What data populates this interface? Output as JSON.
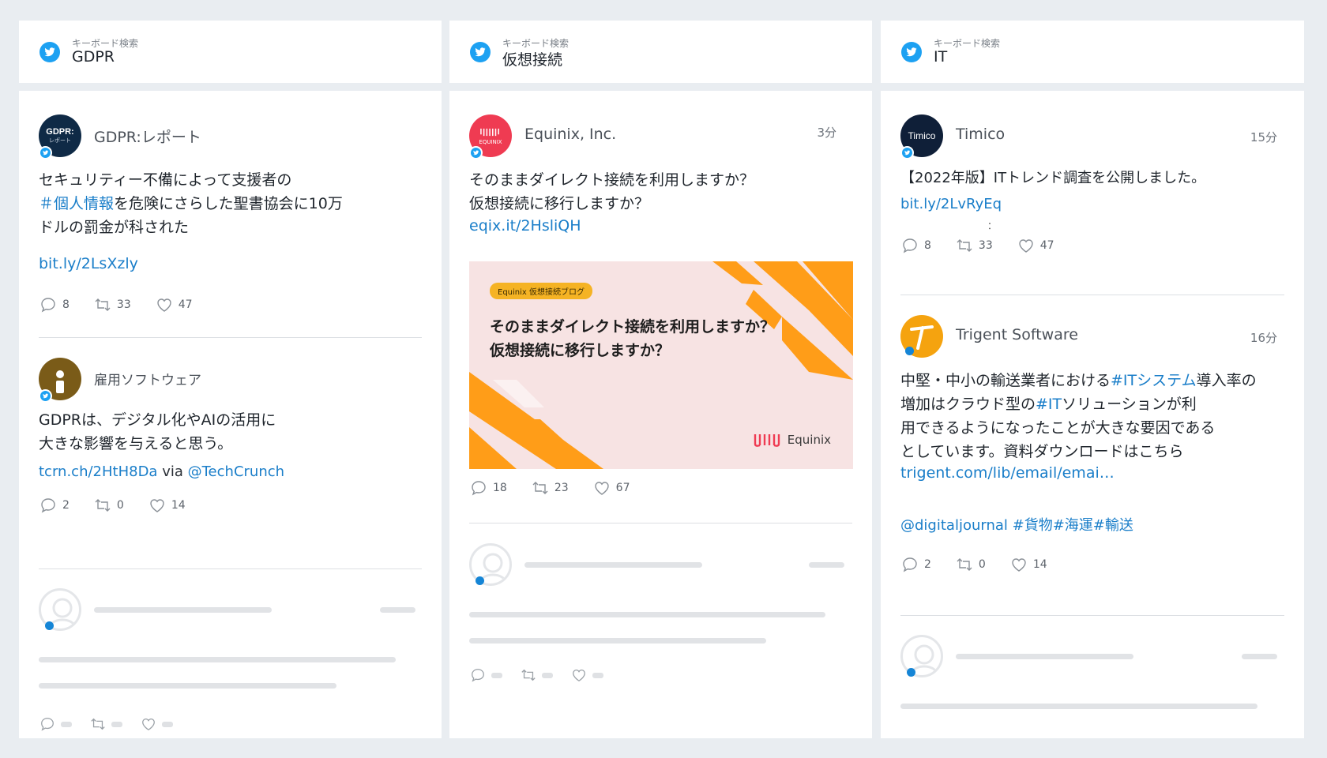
{
  "colors": {
    "twitter_blue": "#1da1f2",
    "link": "#1a7ec9",
    "equinix_red": "#ef3b52",
    "accent_orange": "#ff9d18"
  },
  "columns": [
    {
      "kicker": "キーボード検索",
      "keyword": "GDPR",
      "tweets": [
        {
          "avatar_text": "GDPR:",
          "avatar_sub": "レポート",
          "name": "GDPR:レポート",
          "text_pre": "セキュリティー不備によって支援者の",
          "hashtag": "＃個人情報",
          "text_post": "を危険にさらした聖書協会に10万\nドルの罰金が科された",
          "link": "bit.ly/2LsXzly",
          "replies": "8",
          "retweets": "33",
          "likes": "47"
        },
        {
          "name": "雇用ソフトウェア",
          "text": "GDPRは、デジタル化やAIの活用に\n大きな影響を与えると思う。",
          "link": "tcrn.ch/2HtH8Da",
          "via": "via",
          "mention": "@TechCrunch",
          "replies": "2",
          "retweets": "0",
          "likes": "14"
        }
      ]
    },
    {
      "kicker": "キーボード検索",
      "keyword": "仮想接続",
      "tweets": [
        {
          "avatar_sub": "EQUINIX",
          "name": "Equinix, Inc.",
          "time": "3分",
          "text": "そのままダイレクト接続を利用しますか？\n仮想接続に移行しますか？",
          "link": "eqix.it/2HsliQH",
          "media": {
            "tag": "Equinix 仮想接続ブログ",
            "headline": "そのままダイレクト接続を利用しますか？\n仮想接続に移行しますか？",
            "brand": "Equinix"
          },
          "replies": "18",
          "retweets": "23",
          "likes": "67"
        }
      ]
    },
    {
      "kicker": "キーボード検索",
      "keyword": "IT",
      "tweets": [
        {
          "avatar_text": "Timico",
          "name": "Timico",
          "time": "15分",
          "text": "【2022年版】ITトレンド調査を公開しました。",
          "link": "bit.ly/2LvRyEq",
          "ellipsis": "：",
          "replies": "8",
          "retweets": "33",
          "likes": "47"
        },
        {
          "name": "Trigent Software",
          "time": "16分",
          "l1_pre": "中堅・中小の輸送業者における",
          "l1_tag": "#ITシステム",
          "l1_post": "導入率の",
          "l2_pre": "増加はクラウド型の",
          "l2_tag": "#IT",
          "l2_post": "ソリューションが利",
          "l3": "用できるようになったことが大きな要因である\nとしています。資料ダウンロードはこちら",
          "link": "trigent.com/lib/email/emai…",
          "tags": "@digitaljournal #貨物#海運#輸送",
          "replies": "2",
          "retweets": "0",
          "likes": "14"
        }
      ]
    }
  ]
}
